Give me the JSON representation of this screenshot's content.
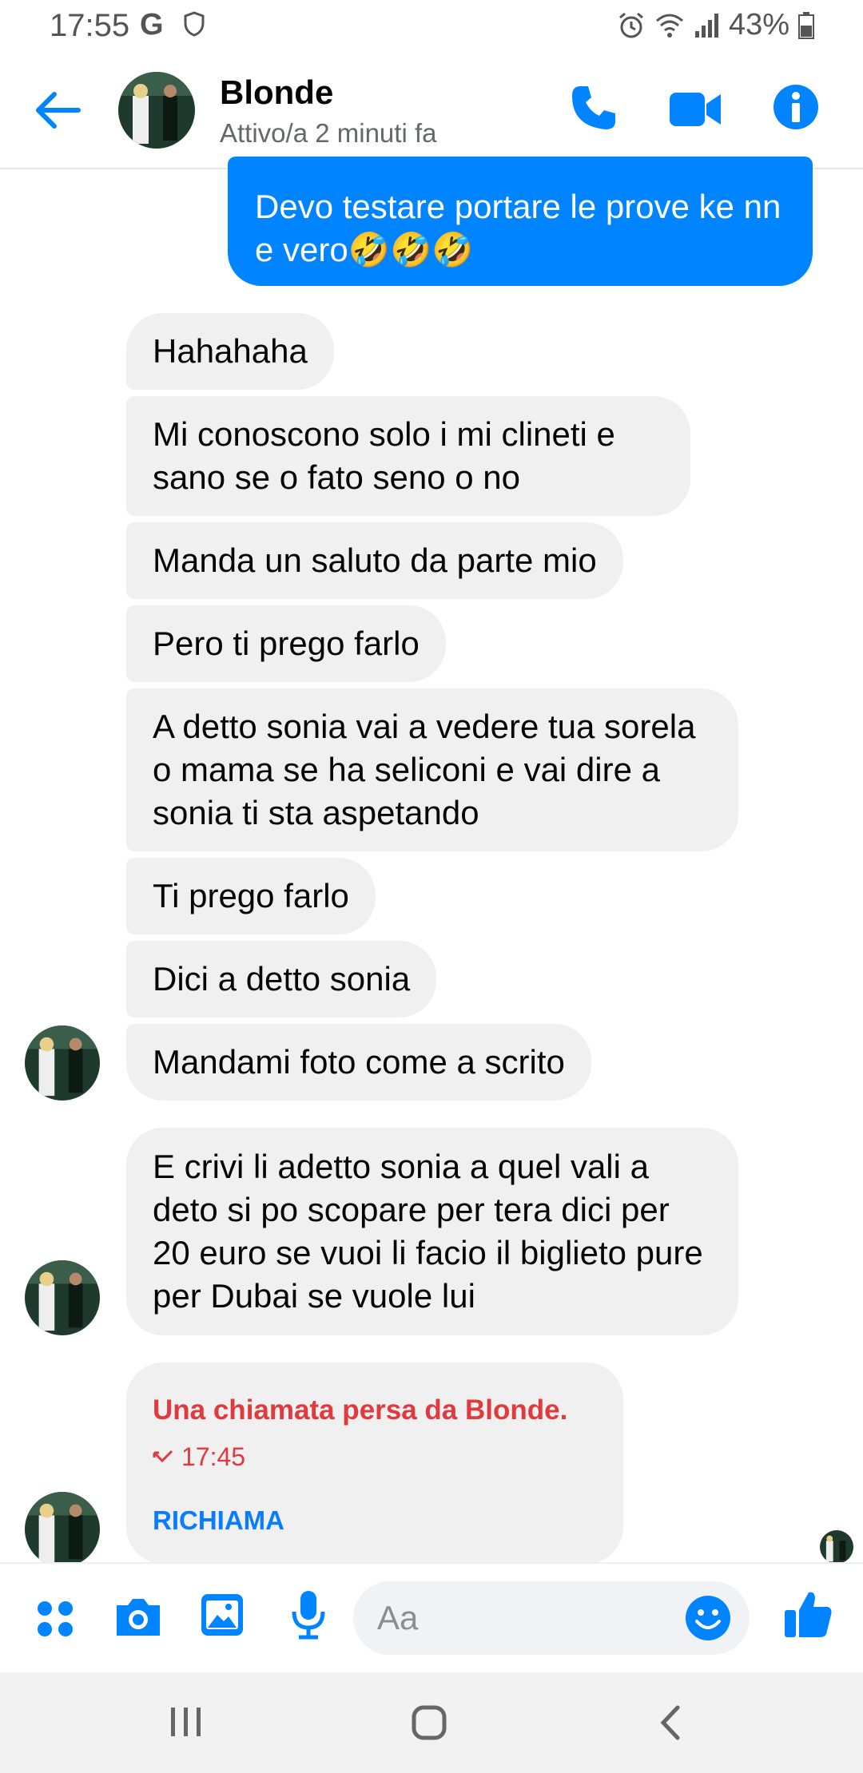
{
  "status": {
    "time": "17:55",
    "g_badge": "G",
    "battery": "43%"
  },
  "header": {
    "name": "Blonde",
    "presence": "Attivo/a 2 minuti fa"
  },
  "outgoing": {
    "text": "Devo testare portare le prove ke nn e vero🤣🤣🤣"
  },
  "incoming": [
    "Hahahaha",
    "Mi conoscono solo i mi clineti e sano se o fato seno o no",
    "Manda un saluto da parte mio",
    "Pero ti prego farlo",
    "A detto sonia vai a vedere tua sorela o mama se ha seliconi e vai dire a sonia ti sta aspetando",
    "Ti prego farlo",
    "Dici a detto sonia",
    "Mandami foto come a scrito",
    "E crivi li  adetto sonia  a quel vali  a deto si po scopare per tera dici per 20 euro se vuoi li facio il biglieto pure per Dubai se vuole lui"
  ],
  "missed_call": {
    "title": "Una chiamata persa da Blonde.",
    "time": "17:45",
    "action": "RICHIAMA"
  },
  "composer": {
    "placeholder": "Aa"
  },
  "colors": {
    "accent": "#0084ff",
    "missed": "#e0393e",
    "bubble_incoming": "#f0f0f0"
  },
  "icons": [
    "back-arrow-icon",
    "phone-icon",
    "video-camera-icon",
    "info-icon",
    "apps-icon",
    "camera-icon",
    "gallery-icon",
    "microphone-icon",
    "emoji-icon",
    "thumbs-up-icon",
    "missed-call-icon"
  ]
}
